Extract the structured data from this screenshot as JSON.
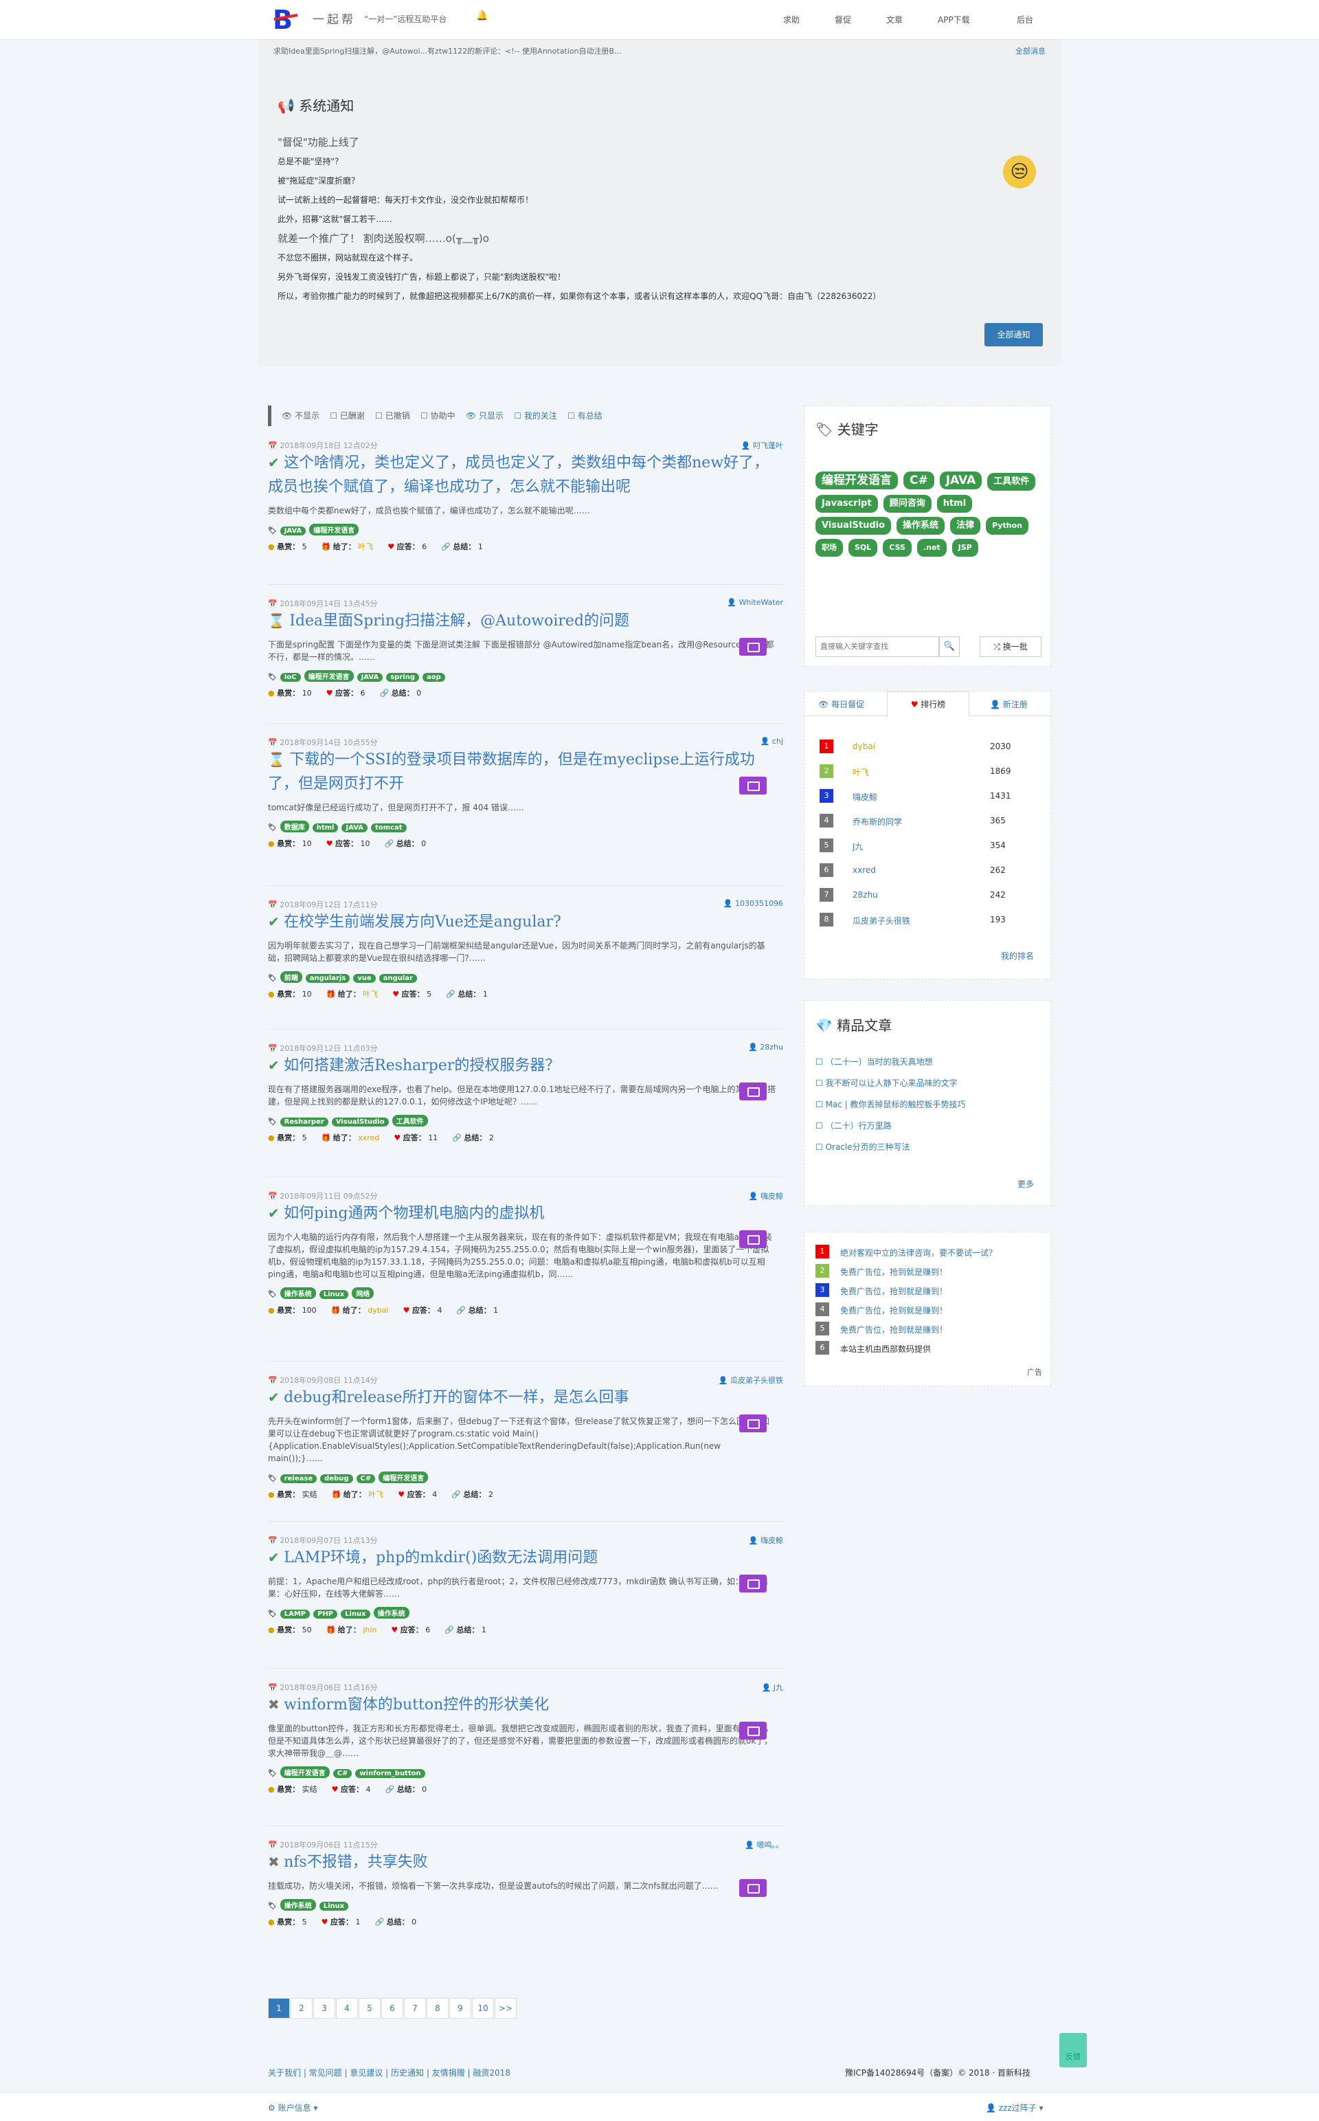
{
  "nav": {
    "brand": "一起帮",
    "slogan": "“一对一”远程互助平台",
    "links": [
      "求助",
      "督促",
      "文章",
      "APP下载",
      "后台"
    ]
  },
  "notice": {
    "help_line": "求助Idea里面Spring扫描注解，@Autowoi...有ztw1122的新评论：<!-- 使用Annotation自动注册B...",
    "all_msg": "全部消息",
    "title": "系统通知",
    "lines": [
      "\"督促\"功能上线了",
      "总是不能\"坚持\"？",
      "被\"拖延症\"深度折磨？",
      "试一试新上线的一起督督吧：每天打卡文作业，没交作业就扣帮帮币！",
      "此外，招募\"这就\"督工若干……",
      "就差一个推广了！ 割肉送股权啊……o(╥﹏╥)o",
      "不忿您不圈拼，网站就现在这个样子。",
      "另外飞哥保穷，没钱发工资没钱打广告，标题上都说了，只能\"割肉送股权\"啦！",
      "所以，考验你推广能力的时候到了，就像超把这视频都买上6/7K的高价一样，如果你有这个本事，或者认识有这样本事的人，欢迎QQ飞哥：自由飞（2282636022）"
    ],
    "btn": "全部通知"
  },
  "filters": [
    "不显示",
    "已酬谢",
    "已撤销",
    "协助中",
    "只显示",
    "我的关注",
    "有总结"
  ],
  "items": [
    {
      "date": "2018年09月18日 12点02分",
      "user": "叼飞蓬叶",
      "title": "这个啥情况，类也定义了，成员也定义了，类数组中每个类都new好了，成员也挨个赋值了，编译也成功了，怎么就不能输出呢",
      "desc": "类数组中每个类都new好了，成员也挨个赋值了，编译也成功了，怎么就不能输出呢……",
      "tags": [
        "JAVA",
        "编程开发语言"
      ],
      "reward": "5",
      "giver": "叶飞",
      "answers": "6",
      "summary": "1",
      "icon": "✔"
    },
    {
      "date": "2018年09月14日 13点45分",
      "user": "WhiteWater",
      "title": "Idea里面Spring扫描注解，@Autowoired的问题",
      "desc": "下面是spring配置 下面是作为变量的类 下面是测试类注解 下面是报错部分 @Autowired加name指定bean名，改用@Resource注解，都不行，都是一样的情况。……",
      "tags": [
        "IoC",
        "编程开发语言",
        "JAVA",
        "spring",
        "aop"
      ],
      "reward": "10",
      "giver": "",
      "answers": "6",
      "summary": "0",
      "icon": "⌛"
    },
    {
      "date": "2018年09月14日 10点55分",
      "user": "chj",
      "title": "下载的一个SSI的登录项目带数据库的，但是在myeclipse上运行成功了，但是网页打不开",
      "desc": "tomcat好像是已经运行成功了，但是网页打开不了，报 404 错误……",
      "tags": [
        "数据库",
        "html",
        "JAVA",
        "tomcat"
      ],
      "reward": "10",
      "giver": "",
      "answers": "10",
      "summary": "0",
      "icon": "⌛"
    },
    {
      "date": "2018年09月12日 17点11分",
      "user": "1030351096",
      "title": "在校学生前端发展方向Vue还是angular?",
      "desc": "因为明年就要去实习了，现在自己想学习一门前端框架纠结是angular还是Vue，因为时间关系不能两门同时学习，之前有angularjs的基础，招聘网站上都要求的是Vue现在很纠结选择哪一门?……",
      "tags": [
        "前端",
        "angularjs",
        "vue",
        "angular"
      ],
      "reward": "10",
      "giver": "叶飞",
      "answers": "5",
      "summary": "1",
      "icon": "✔"
    },
    {
      "date": "2018年09月12日 11点03分",
      "user": "28zhu",
      "title": "如何搭建激活Resharper的授权服务器？",
      "desc": "现在有了搭建服务器端用的exe程序，也看了help。但是在本地使用127.0.0.1地址已经不行了，需要在局域网内另一个电脑上的某个IP上搭建，但是网上找到的都是默认的127.0.0.1，如何修改这个IP地址呢？……",
      "tags": [
        "Resharper",
        "VisualStudio",
        "工具软件"
      ],
      "reward": "5",
      "giver": "xxred",
      "answers": "11",
      "summary": "2",
      "icon": "✔"
    },
    {
      "date": "2018年09月11日 09点52分",
      "user": "嗨皮鲸",
      "title": "如何ping通两个物理机电脑内的虚拟机",
      "desc": "因为个人电脑的运行内存有限，然后我个人想搭建一个主从服务器来玩，现在有的条件如下：虚拟机软件都是VM；我现在有电脑a，里面装了虚拟机，假设虚拟机电脑的ip为157.29.4.154，子网掩码为255.255.0.0；然后有电脑b(实际上是一个win服务器)，里面装了一个虚拟机b，假设物理机电脑的ip为157.33.1.18，子网掩码为255.255.0.0；问题：电脑a和虚拟机a能互相ping通，电脑b和虚拟机b可以互相ping通，电脑a和电脑b也可以互相ping通，但是电脑a无法ping通虚拟机b，同……",
      "tags": [
        "操作系统",
        "Linux",
        "网络"
      ],
      "reward": "100",
      "giver": "dybai",
      "answers": "4",
      "summary": "1",
      "icon": "✔"
    },
    {
      "date": "2018年09月08日 11点14分",
      "user": "瓜皮弟子头很铁",
      "title": "debug和release所打开的窗体不一样，是怎么回事",
      "desc": "先开头在winform创了一个form1窗体，后来删了，但debug了一下还有这个窗体，但release了就又恢复正常了，想问一下怎么回事，如果可以让在debug下也正常调试就更好了program.cs:static void Main(){Application.EnableVisualStyles();Application.SetCompatibleTextRenderingDefault(false);Application.Run(new main());}……",
      "tags": [
        "release",
        "debug",
        "C#",
        "编程开发语言"
      ],
      "reward": "实结",
      "giver": "叶飞",
      "answers": "4",
      "summary": "2",
      "icon": "✔"
    },
    {
      "date": "2018年09月07日 11点13分",
      "user": "嗨皮鲸",
      "title": "LAMP环境，php的mkdir()函数无法调用问题",
      "desc": "前提：1，Apache用户和组已经改成root，php的执行者是root；2，文件权限已经修改成7773，mkdir函数 确认书写正确，如：报错结果：心好压抑，在线等大佬解答……",
      "tags": [
        "LAMP",
        "PHP",
        "Linux",
        "操作系统"
      ],
      "reward": "50",
      "giver": "jhin",
      "answers": "6",
      "summary": "1",
      "icon": "✔"
    },
    {
      "date": "2018年09月06日 11点16分",
      "user": "J九",
      "title": "winform窗体的button控件的形状美化",
      "desc": "像里面的button控件，我正方形和长方形都觉得老土，很单调。我想把它改变成圆形，椭圆形或者别的形状，我查了资料，里面有源代码，但是不知道具体怎么弄，这个形状已经算最很好了的了，但还是感觉不好看，需要把里面的参数设置一下，改成圆形或者椭圆形的就ok了，求大神带带我@＿@……",
      "tags": [
        "编程开发语言",
        "C#",
        "winform_button"
      ],
      "reward": "实结",
      "giver": "",
      "answers": "4",
      "summary": "0",
      "icon": "✖"
    },
    {
      "date": "2018年09月06日 11点15分",
      "user": "嗯呜。。",
      "title": "nfs不报错，共享失败",
      "desc": "挂载成功，防火墙关闭，不报错，烦恼看一下第一次共享成功，但是设置autofs的时候出了问题，第二次nfs就出问题了……",
      "tags": [
        "操作系统",
        "Linux"
      ],
      "reward": "5",
      "giver": "",
      "answers": "1",
      "summary": "0",
      "icon": "✖"
    }
  ],
  "labels": {
    "reward": "悬赏：",
    "giver": "给了：",
    "answers": "应答：",
    "summary": "总结："
  },
  "pager": [
    "1",
    "2",
    "3",
    "4",
    "5",
    "6",
    "7",
    "8",
    "9",
    "10",
    ">>"
  ],
  "keywords": {
    "title": "关键字",
    "tags": [
      "编程开发语言",
      "C#",
      "JAVA",
      "工具软件",
      "Javascript",
      "顾问咨询",
      "html",
      "VisualStudio",
      "操作系统",
      "法律",
      "Python",
      "职场",
      "SQL",
      "CSS",
      ".net",
      "JSP"
    ],
    "placeholder": "直接输入关键字查找",
    "refresh": "换一批"
  },
  "rank": {
    "tabs": [
      "每日督促",
      "排行榜",
      "新注册"
    ],
    "rows": [
      {
        "n": "1",
        "name": "dybai",
        "v": "2030",
        "c": "#e00"
      },
      {
        "n": "2",
        "name": "叶飞",
        "v": "1869",
        "c": "#8bc34a"
      },
      {
        "n": "3",
        "name": "嗨皮鲸",
        "v": "1431",
        "c": "#1a3bd8"
      },
      {
        "n": "4",
        "name": "乔布斯的同学",
        "v": "365",
        "c": "#777"
      },
      {
        "n": "5",
        "name": "J九",
        "v": "354",
        "c": "#777"
      },
      {
        "n": "6",
        "name": "xxred",
        "v": "262",
        "c": "#777"
      },
      {
        "n": "7",
        "name": "28zhu",
        "v": "242",
        "c": "#777"
      },
      {
        "n": "8",
        "name": "瓜皮弟子头很铁",
        "v": "193",
        "c": "#777"
      }
    ],
    "mine": "我的排名"
  },
  "articles": {
    "title": "精品文章",
    "items": [
      "（二十一）当时的我天真地想",
      "我不断可以让人静下心来品味的文字",
      "Mac | 教你丢掉鼠标的触控板手势技巧",
      "（二十）行万里路",
      "Oracle分页的三种写法"
    ],
    "more": "更多"
  },
  "ads": {
    "items": [
      "绝对客观中立的法律咨询，要不要试一试？",
      "免费广告位，抢到就是赚到！",
      "免费广告位，抢到就是赚到！",
      "免费广告位，抢到就是赚到！",
      "免费广告位，抢到就是赚到！",
      "本站主机由西部数码提供"
    ],
    "label": "广告"
  },
  "footer": {
    "links": "关于我们 | 常见问题 | 意见建议 | 历史通知 | 友情捐赠 | 融资2018",
    "icp": "豫ICP备14028694号（备案）© 2018 · 首新科技",
    "feedback": "反馈",
    "account": "账户信息",
    "user": "zzz过阵子"
  }
}
